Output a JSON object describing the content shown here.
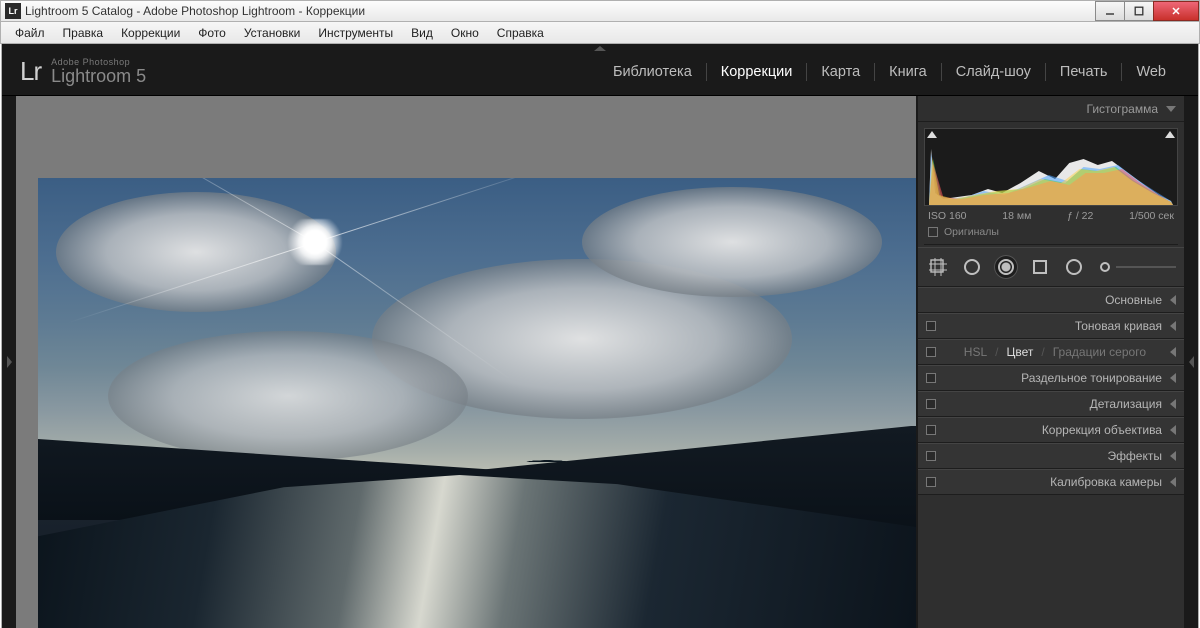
{
  "window": {
    "title": "Lightroom 5 Catalog - Adobe Photoshop Lightroom - Коррекции",
    "app_icon_text": "Lr"
  },
  "menubar": [
    "Файл",
    "Правка",
    "Коррекции",
    "Фото",
    "Установки",
    "Инструменты",
    "Вид",
    "Окно",
    "Справка"
  ],
  "brand": {
    "lr": "Lr",
    "small": "Adobe Photoshop",
    "big": "Lightroom 5"
  },
  "modules": [
    {
      "label": "Библиотека",
      "active": false
    },
    {
      "label": "Коррекции",
      "active": true
    },
    {
      "label": "Карта",
      "active": false
    },
    {
      "label": "Книга",
      "active": false
    },
    {
      "label": "Слайд-шоу",
      "active": false
    },
    {
      "label": "Печать",
      "active": false
    },
    {
      "label": "Web",
      "active": false
    }
  ],
  "histogram": {
    "header": "Гистограмма",
    "iso": "ISO 160",
    "focal": "18 мм",
    "aperture": "ƒ / 22",
    "shutter": "1/500 сек",
    "originals": "Оригиналы"
  },
  "hsl_tabs": {
    "hsl": "HSL",
    "color": "Цвет",
    "bw": "Градации серого"
  },
  "panels": [
    "Основные",
    "Тоновая кривая",
    "__HSL__",
    "Раздельное тонирование",
    "Детализация",
    "Коррекция объектива",
    "Эффекты",
    "Калибровка камеры"
  ]
}
